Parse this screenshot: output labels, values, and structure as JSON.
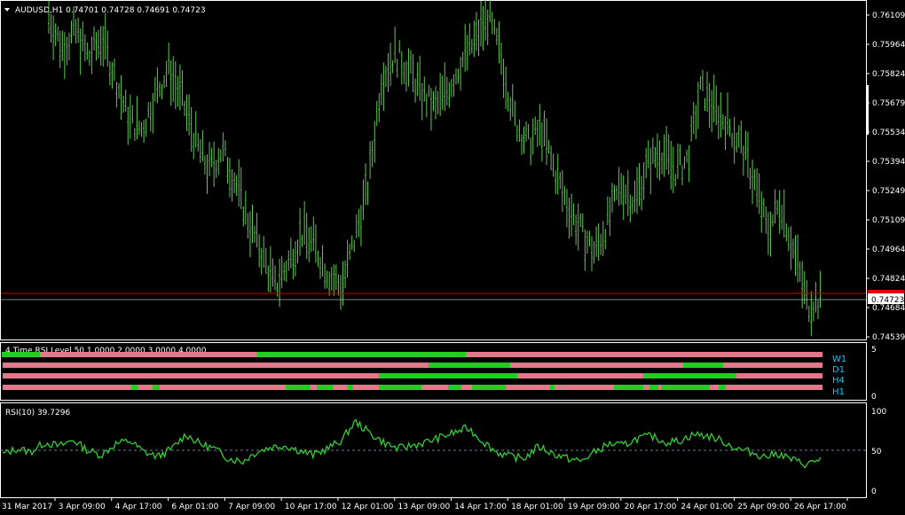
{
  "main": {
    "symbol_header": "AUDUSD,H1  0.74701 0.74728 0.74691 0.74723",
    "current_price": "0.74723",
    "price_ticks": [
      "0.76109",
      "0.75964",
      "0.75824",
      "0.75679",
      "0.75534",
      "0.75394",
      "0.75249",
      "0.75109",
      "0.74964",
      "0.74824",
      "0.74684",
      "0.74539"
    ]
  },
  "indicator_mtf": {
    "title": "4 Time RSI Level 50 1.0000 2.0000 3.0000 4.0000",
    "scale_top": "5",
    "scale_bottom": "0",
    "rows": [
      "W1",
      "D1",
      "H4",
      "H1"
    ]
  },
  "indicator_rsi": {
    "title": "RSI(10) 39.7296",
    "levels": [
      "100",
      "50",
      "0"
    ]
  },
  "time_axis": [
    "31 Mar 2017",
    "3 Apr 09:00",
    "4 Apr 17:00",
    "6 Apr 01:00",
    "7 Apr 09:00",
    "10 Apr 17:00",
    "12 Apr 01:00",
    "13 Apr 09:00",
    "14 Apr 17:00",
    "18 Apr 01:00",
    "19 Apr 09:00",
    "20 Apr 17:00",
    "24 Apr 01:00",
    "25 Apr 09:00",
    "26 Apr 17:00"
  ],
  "colors": {
    "background": "#000000",
    "candle": "#5ec84f",
    "bid_line": "#c80000",
    "rsi_line": "#32cd32",
    "bar_pink": "#e07a8a",
    "bar_green": "#22cc22",
    "legend": "#00d0ff",
    "grid": "#ffffff"
  },
  "chart_data": {
    "type": "line",
    "series": [
      {
        "name": "AUDUSD,H1",
        "values": [
          0.761,
          0.7595,
          0.7603,
          0.759,
          0.76,
          0.758,
          0.756,
          0.7555,
          0.7572,
          0.7585,
          0.757,
          0.755,
          0.7535,
          0.7545,
          0.753,
          0.751,
          0.7495,
          0.7478,
          0.749,
          0.7505,
          0.7498,
          0.7485,
          0.7478,
          0.7502,
          0.7528,
          0.758,
          0.7592,
          0.7585,
          0.7573,
          0.7565,
          0.7575,
          0.7588,
          0.7598,
          0.761,
          0.759,
          0.756,
          0.7548,
          0.7555,
          0.7535,
          0.7518,
          0.7505,
          0.7495,
          0.751,
          0.7528,
          0.752,
          0.7538,
          0.7545,
          0.7535,
          0.754,
          0.7575,
          0.7565,
          0.7558,
          0.7548,
          0.753,
          0.7505,
          0.752,
          0.7495,
          0.747,
          0.7472
        ]
      },
      {
        "name": "RSI(10)",
        "values": [
          45,
          52,
          48,
          60,
          55,
          63,
          50,
          44,
          58,
          62,
          48,
          42,
          52,
          70,
          58,
          52,
          40,
          36,
          48,
          54,
          56,
          50,
          44,
          52,
          62,
          86,
          72,
          60,
          52,
          56,
          60,
          66,
          72,
          78,
          62,
          48,
          42,
          40,
          55,
          46,
          40,
          36,
          48,
          58,
          56,
          65,
          68,
          60,
          62,
          70,
          68,
          62,
          52,
          48,
          42,
          46,
          38,
          32,
          39.73
        ]
      }
    ],
    "ylim": [
      0.74539,
      0.76109
    ]
  }
}
